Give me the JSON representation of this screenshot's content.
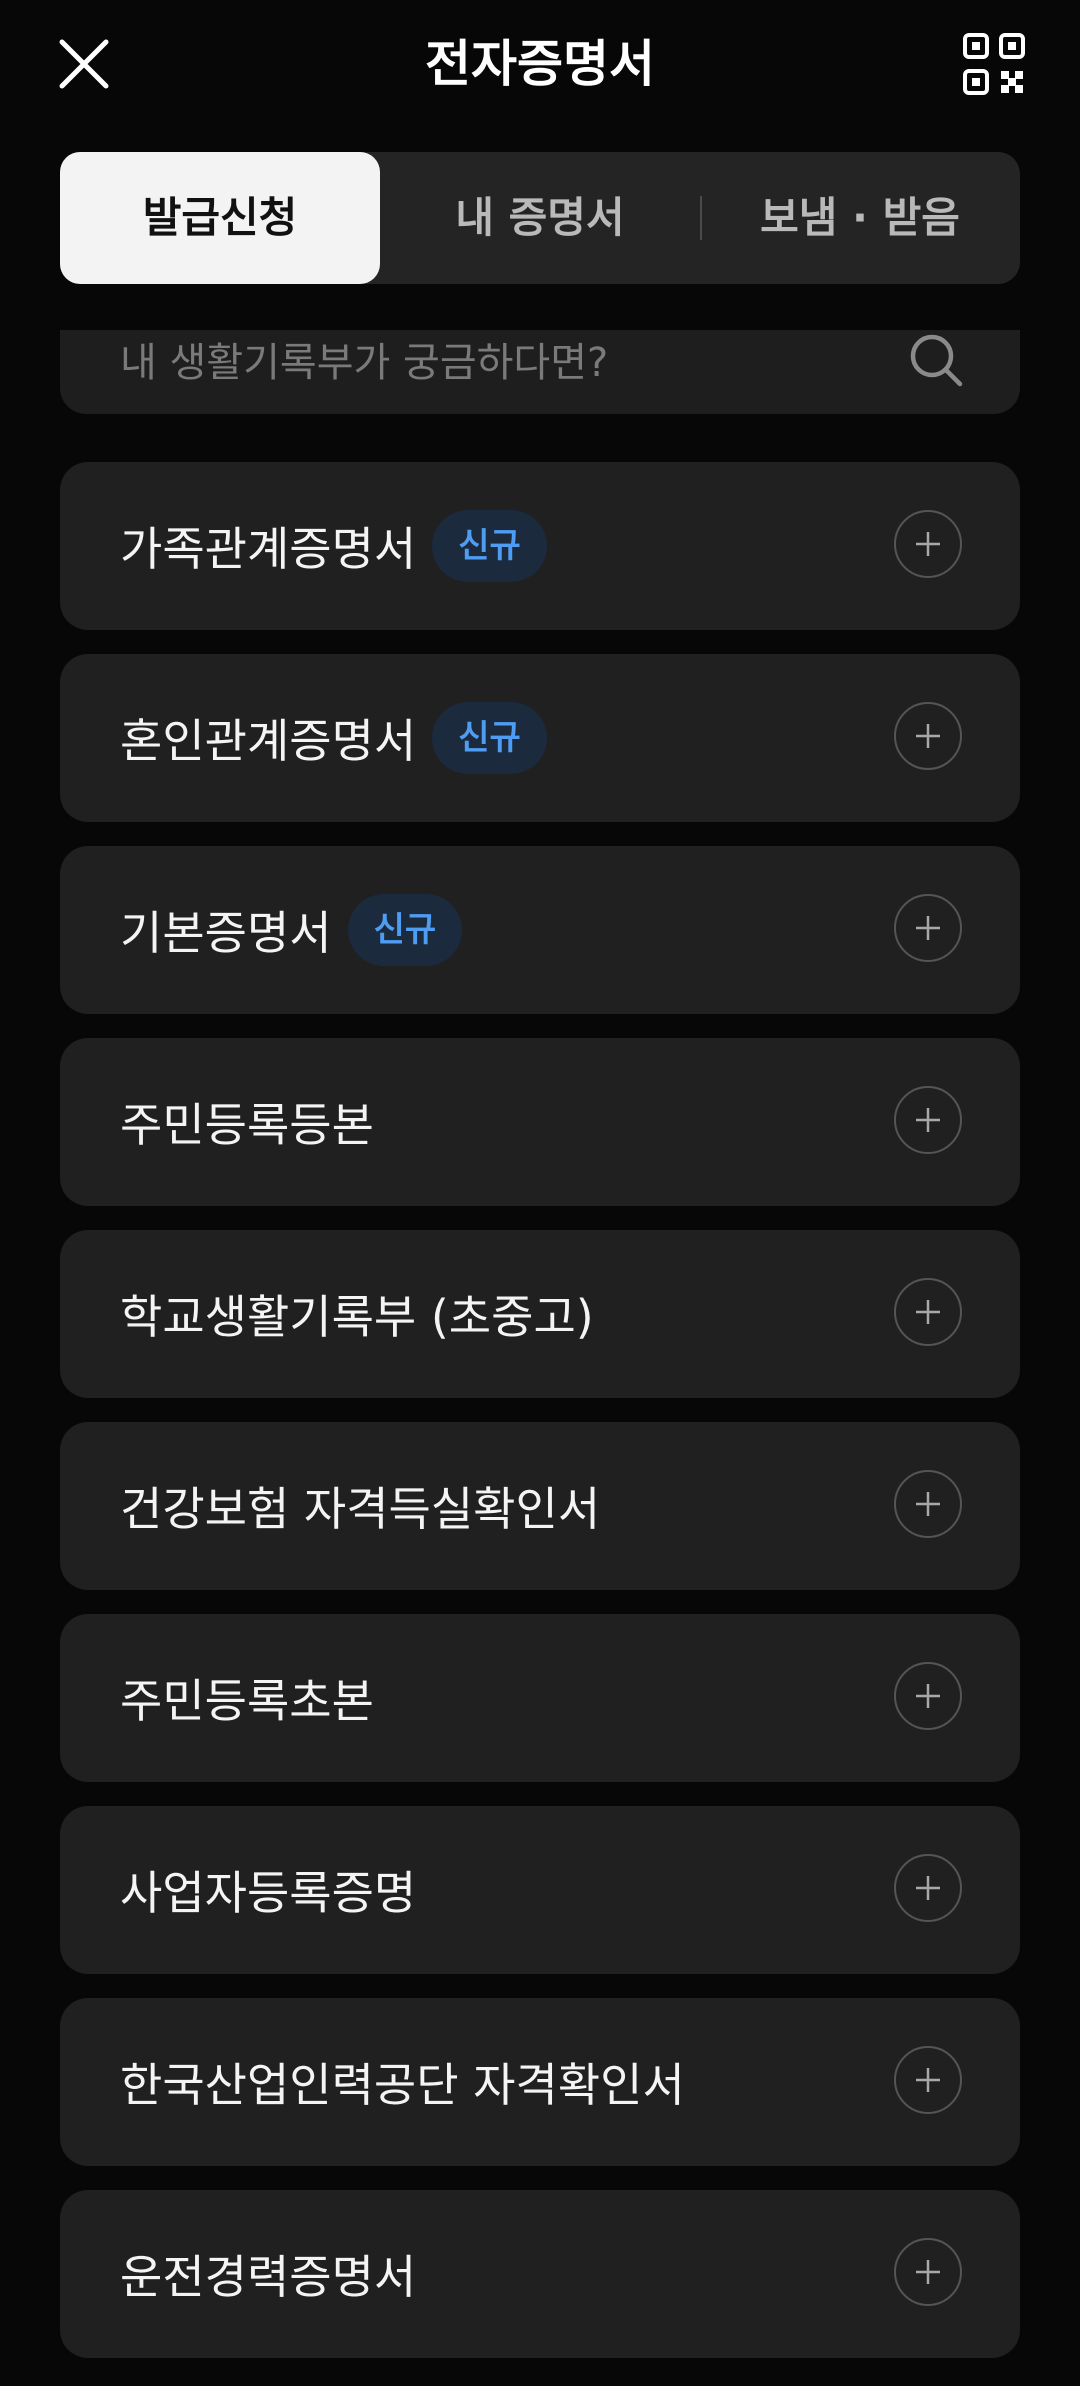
{
  "header": {
    "title": "전자증명서",
    "close_icon": "close-icon",
    "qr_icon": "qr-code-icon"
  },
  "tabs": [
    {
      "label": "발급신청",
      "active": true
    },
    {
      "label": "내 증명서",
      "active": false
    },
    {
      "label": "보냄 · 받음",
      "active": false
    }
  ],
  "search": {
    "placeholder": "내 생활기록부가 궁금하다면?",
    "icon": "search-icon"
  },
  "items": [
    {
      "label": "가족관계증명서",
      "badge": "신규"
    },
    {
      "label": "혼인관계증명서",
      "badge": "신규"
    },
    {
      "label": "기본증명서",
      "badge": "신규"
    },
    {
      "label": "주민등록등본",
      "badge": ""
    },
    {
      "label": "학교생활기록부 (초중고)",
      "badge": ""
    },
    {
      "label": "건강보험 자격득실확인서",
      "badge": ""
    },
    {
      "label": "주민등록초본",
      "badge": ""
    },
    {
      "label": "사업자등록증명",
      "badge": ""
    },
    {
      "label": "한국산업인력공단 자격확인서",
      "badge": ""
    },
    {
      "label": "운전경력증명서",
      "badge": ""
    }
  ],
  "colors": {
    "background": "#070707",
    "card": "#202020",
    "badge_text": "#4f9cf3",
    "badge_bg": "#1c2a3e",
    "active_tab": "#f3f3f3"
  }
}
